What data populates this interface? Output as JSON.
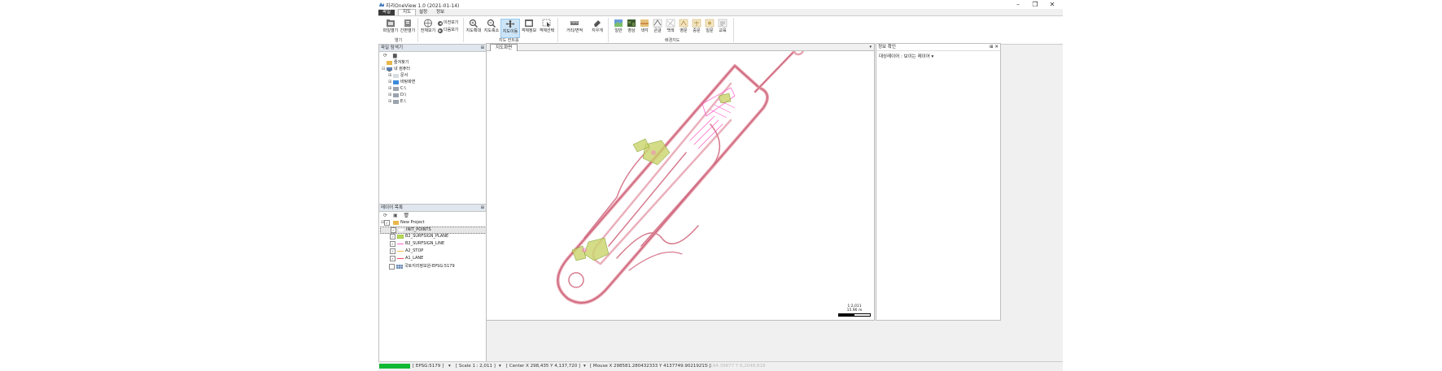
{
  "window": {
    "title": "지리OneView 1.0 (2021-01-14)",
    "controls": [
      "–",
      "❐",
      "✕"
    ]
  },
  "menu_tabs": [
    "파일",
    "지도",
    "설정",
    "정보"
  ],
  "ribbon": {
    "file_group": {
      "buttons": [
        "파일열기",
        "간편열기"
      ],
      "group_label": "열기"
    },
    "nav_group": {
      "buttons": [
        "전체보기"
      ],
      "stack": [
        "이전보기",
        "다음보기"
      ],
      "zoom_buttons": [
        "지도확대",
        "지도축소",
        "지도이동",
        "객체정보",
        "객체선택"
      ],
      "group_label": "지도 컨트롤"
    },
    "measure_group": {
      "buttons": [
        "거리/면적",
        "지우개"
      ]
    },
    "basemap_group": {
      "buttons": [
        "일반",
        "영상",
        "색각",
        "큰글",
        "백색",
        "영문",
        "중문",
        "일문",
        "교육"
      ],
      "group_label": "배경지도"
    }
  },
  "file_explorer": {
    "title": "파일 탐색기",
    "nodes": [
      {
        "label": "즐겨찾기",
        "indent": 0
      },
      {
        "label": "내 컴퓨터",
        "indent": 0
      },
      {
        "label": "문서",
        "indent": 1
      },
      {
        "label": "바탕화면",
        "indent": 1
      },
      {
        "label": "C:\\",
        "indent": 1
      },
      {
        "label": "D:\\",
        "indent": 1
      },
      {
        "label": "E:\\",
        "indent": 1
      }
    ]
  },
  "layer_list": {
    "title": "레이어 목록",
    "project": "New Project",
    "layers": [
      {
        "name": "INIT_POINTS",
        "checked": true,
        "color": "#ffffff",
        "selected": true
      },
      {
        "name": "B2_SURFSIGN_PLANE",
        "checked": true,
        "color": "#b7d957",
        "selected": false
      },
      {
        "name": "B2_SURFSIGN_LINE",
        "checked": true,
        "color": "#ff66cc",
        "selected": false
      },
      {
        "name": "A2_STOP",
        "checked": true,
        "color": "#ffbb55",
        "selected": false
      },
      {
        "name": "A1_LANE",
        "checked": true,
        "color": "#ff4466",
        "selected": false
      }
    ],
    "basemap": "국토지리정보원-EPSG:5179"
  },
  "map": {
    "tab": "지도화면",
    "scale_text": "1:2,011",
    "scale_bar_label": "15.96 m"
  },
  "info_panel": {
    "title": "정보 확인",
    "target_label": "대상레이어 :",
    "target_value": "보이는 레이어"
  },
  "status": {
    "items": [
      "[ EPSG:5179 ]",
      "▾",
      "[ Scale 1 : 2,011 ]",
      "▾",
      "[ Center X 298,435 Y 4,137,720 ]",
      "▾",
      "[ Mouse X 298581.280432333 Y 4137749.90219215 ]"
    ],
    "faded": "Y 4,194.39877 Y 6,2048,818"
  }
}
